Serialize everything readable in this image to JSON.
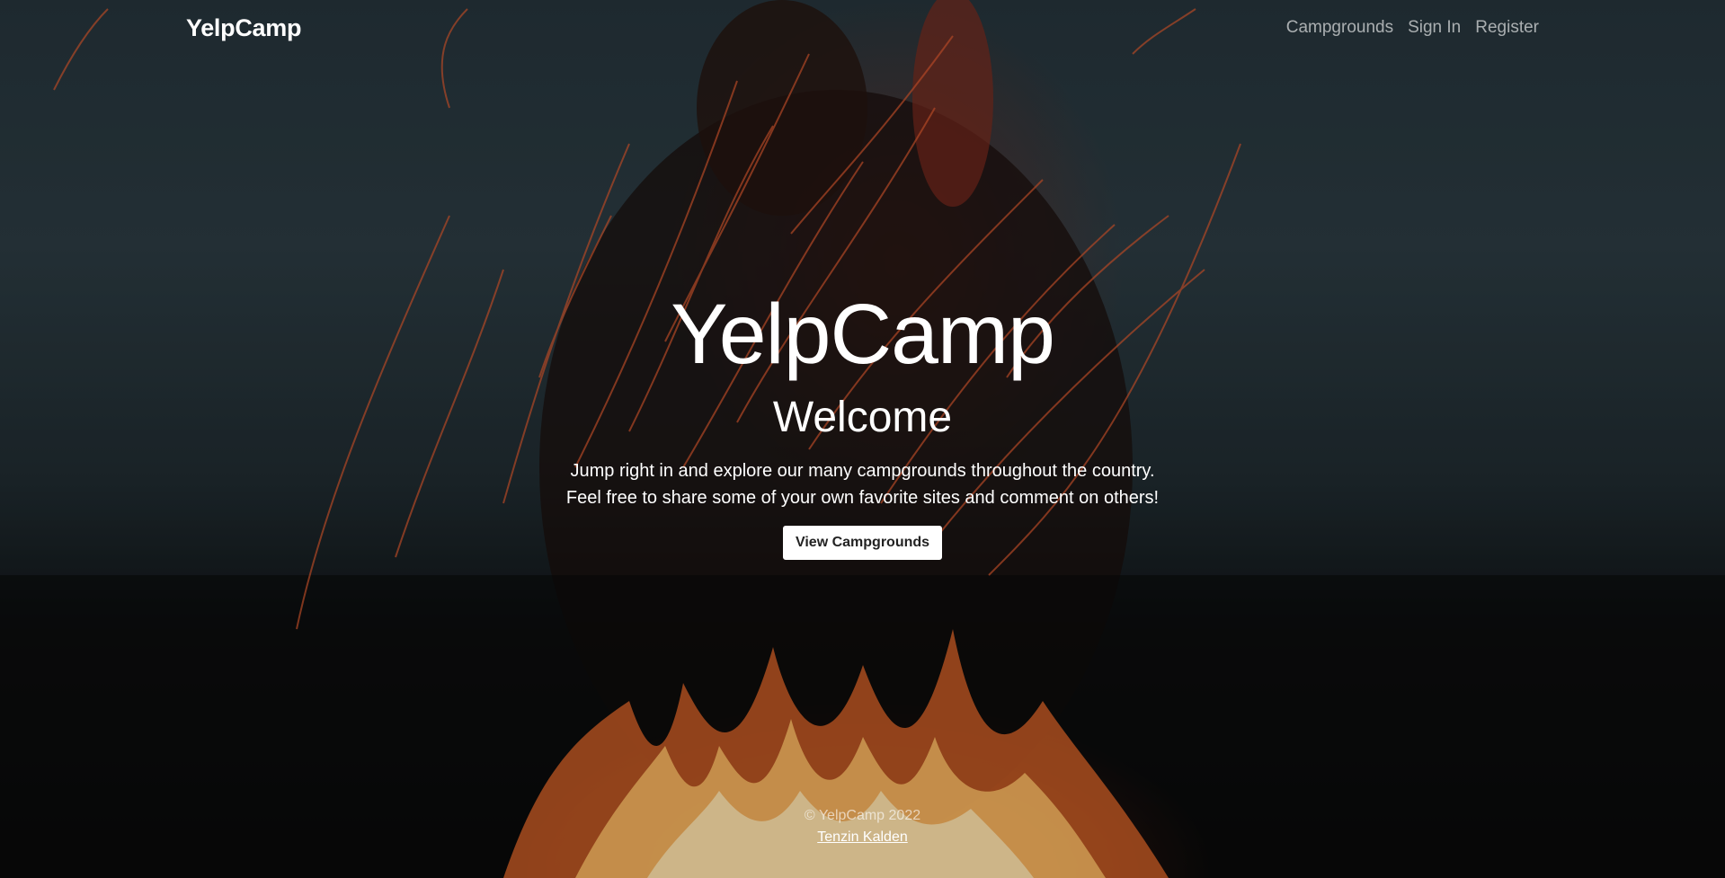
{
  "nav": {
    "brand": "YelpCamp",
    "links": [
      {
        "label": "Campgrounds"
      },
      {
        "label": "Sign In"
      },
      {
        "label": "Register"
      }
    ]
  },
  "hero": {
    "title": "YelpCamp",
    "subtitle": "Welcome",
    "line1": "Jump right in and explore our many campgrounds throughout the country.",
    "line2": "Feel free to share some of your own favorite sites and comment on others!",
    "button_label": "View Campgrounds"
  },
  "footer": {
    "copyright": "© YelpCamp 2022",
    "author": "Tenzin Kalden"
  },
  "background": {
    "description_icon": "campfire-sparks-photo",
    "colors": {
      "sky": "#2b3a41",
      "flame": "#ff9a3c",
      "spark": "#d9582e"
    }
  }
}
